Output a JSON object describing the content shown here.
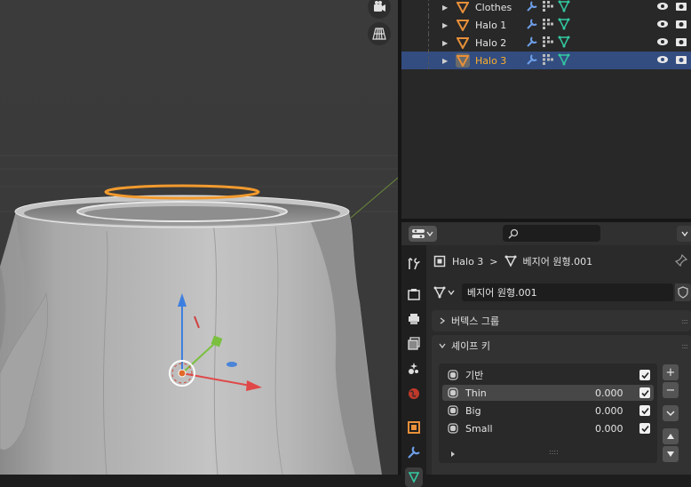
{
  "viewport": {
    "nav_icons": [
      "camera-view-icon",
      "perspective-grid-icon"
    ]
  },
  "outliner": {
    "rows": [
      {
        "label": "Clothes",
        "selected": false
      },
      {
        "label": "Halo 1",
        "selected": false
      },
      {
        "label": "Halo 2",
        "selected": false
      },
      {
        "label": "Halo 3",
        "selected": true
      }
    ]
  },
  "properties": {
    "breadcrumb_object": "Halo 3",
    "breadcrumb_sep": ">",
    "breadcrumb_mesh": "베지어 원형.001",
    "mesh_name": "베지어 원형.001",
    "panels": {
      "vertex_groups": "버텍스 그룹",
      "shape_keys": "셰이프 키"
    },
    "shape_keys": [
      {
        "name": "기반",
        "value": "",
        "checked": true,
        "selected": false
      },
      {
        "name": "Thin",
        "value": "0.000",
        "checked": true,
        "selected": true
      },
      {
        "name": "Big",
        "value": "0.000",
        "checked": true,
        "selected": false
      },
      {
        "name": "Small",
        "value": "0.000",
        "checked": true,
        "selected": false
      }
    ],
    "buttons": {
      "add": "+",
      "remove": "−"
    }
  },
  "colors": {
    "selection_bg": "#334d80",
    "active_text": "#ffaf29",
    "mesh_green": "#33c9a1",
    "modifier_blue": "#6e9fe8",
    "object_orange": "#e8903a"
  }
}
